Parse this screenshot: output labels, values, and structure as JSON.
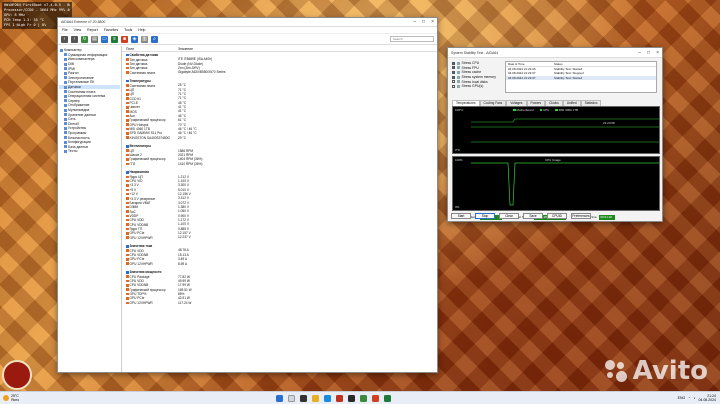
{
  "osd": {
    "lines": [
      "HWiNFO64 FirstBoot v7.4.0.5 - Beta for Intel...",
      "Processor/CCD0 - 3664 MHz 99% 4C/8T...",
      "GPU: 8 MHz",
      "PCH Temp 1.3: 35 °C",
      "FPS 1 Nigh Fr 0 | 0%"
    ]
  },
  "aida": {
    "title": "AIDA64 Extreme v7.20.6800",
    "menu": [
      "File",
      "View",
      "Report",
      "Favorites",
      "Tools",
      "Help"
    ],
    "search_placeholder": "Search",
    "col_field": "Поле",
    "col_value": "Значение",
    "tree": [
      {
        "label": "Компьютер",
        "sel": false
      },
      {
        "label": "Суммарная информация",
        "sel": false
      },
      {
        "label": "Имя компьютера",
        "sel": false
      },
      {
        "label": "DMI",
        "sel": false
      },
      {
        "label": "IPMI",
        "sel": false
      },
      {
        "label": "Разгон",
        "sel": false
      },
      {
        "label": "Электропитание",
        "sel": false
      },
      {
        "label": "Портативные ПК",
        "sel": false
      },
      {
        "label": "Датчики",
        "sel": true
      },
      {
        "label": "Системная плата",
        "sel": false
      },
      {
        "label": "Операционная система",
        "sel": false
      },
      {
        "label": "Сервер",
        "sel": false
      },
      {
        "label": "Отображение",
        "sel": false
      },
      {
        "label": "Мультимедиа",
        "sel": false
      },
      {
        "label": "Хранение данных",
        "sel": false
      },
      {
        "label": "Сеть",
        "sel": false
      },
      {
        "label": "DirectX",
        "sel": false
      },
      {
        "label": "Устройства",
        "sel": false
      },
      {
        "label": "Программы",
        "sel": false
      },
      {
        "label": "Безопасность",
        "sel": false
      },
      {
        "label": "Конфигурация",
        "sel": false
      },
      {
        "label": "База данных",
        "sel": false
      },
      {
        "label": "Тесты",
        "sel": false
      }
    ],
    "rows": [
      {
        "f": "Свойства датчика",
        "v": "",
        "sec": true
      },
      {
        "f": "Тип датчика",
        "v": "ITE IT8689E (ISA A40h)",
        "sec": false
      },
      {
        "f": "Тип датчика",
        "v": "Diode (NV-Diode)",
        "sec": false
      },
      {
        "f": "Тип датчика",
        "v": "Zen (Zen-DRV)",
        "sec": false
      },
      {
        "f": "Системная плата",
        "v": "Gigabyte A520/B550/X570 Series",
        "sec": false
      },
      {
        "f": "",
        "v": "",
        "sec": false
      },
      {
        "f": "Температуры",
        "v": "",
        "sec": true
      },
      {
        "f": "Системная плата",
        "v": "25 °C",
        "sec": false
      },
      {
        "f": "ЦП",
        "v": "71 °C",
        "sec": false
      },
      {
        "f": "ЦП",
        "v": "71 °C",
        "sec": false
      },
      {
        "f": "CCD #1",
        "v": "71 °C",
        "sec": false
      },
      {
        "f": "PCI-E",
        "v": "45 °C",
        "sec": false
      },
      {
        "f": "Чипсет",
        "v": "41 °C",
        "sec": false
      },
      {
        "f": "MOS",
        "v": "41 °C",
        "sec": false
      },
      {
        "f": "Aux",
        "v": "46 °C",
        "sec": false
      },
      {
        "f": "Графический процессор",
        "v": "61 °C",
        "sec": false
      },
      {
        "f": "GPU Hotspot",
        "v": "70 °C",
        "sec": false
      },
      {
        "f": "MSI 4060 1TB",
        "v": "46 °C / 46 °C",
        "sec": false
      },
      {
        "f": "SPD GAMMIX S11 Pro",
        "v": "46 °C / 46 °C",
        "sec": false
      },
      {
        "f": "KINGSTON SA400S37480G",
        "v": "29 °C",
        "sec": false
      },
      {
        "f": "",
        "v": "",
        "sec": false
      },
      {
        "f": "Вентиляторы",
        "v": "",
        "sec": true
      },
      {
        "f": "ЦП",
        "v": "1586 RPM",
        "sec": false
      },
      {
        "f": "Шасси 2",
        "v": "2021 RPM",
        "sec": false
      },
      {
        "f": "Графический процессор",
        "v": "1404 RPM (36%)",
        "sec": false
      },
      {
        "f": "ГП2",
        "v": "1410 RPM (36%)",
        "sec": false
      },
      {
        "f": "",
        "v": "",
        "sec": false
      },
      {
        "f": "Напряжения",
        "v": "",
        "sec": true
      },
      {
        "f": "Ядро ЦП",
        "v": "1.212 V",
        "sec": false
      },
      {
        "f": "CPU VID",
        "v": "1.100 V",
        "sec": false
      },
      {
        "f": "+3.3 V",
        "v": "3.300 V",
        "sec": false
      },
      {
        "f": "+5 V",
        "v": "5.010 V",
        "sec": false
      },
      {
        "f": "+12 V",
        "v": "12.156 V",
        "sec": false
      },
      {
        "f": "+3.3 V резервное",
        "v": "3.312 V",
        "sec": false
      },
      {
        "f": "Батарея VBAT",
        "v": "3.072 V",
        "sec": false
      },
      {
        "f": "DIMM",
        "v": "1.380 V",
        "sec": false
      },
      {
        "f": "SoC",
        "v": "1.050 V",
        "sec": false
      },
      {
        "f": "VDDP",
        "v": "0.900 V",
        "sec": false
      },
      {
        "f": "CPU VDD",
        "v": "1.172 V",
        "sec": false
      },
      {
        "f": "CPU VDDNB",
        "v": "1.100 V",
        "sec": false
      },
      {
        "f": "Ядро ГП",
        "v": "0.885 V",
        "sec": false
      },
      {
        "f": "GPU PCIe",
        "v": "12.157 V",
        "sec": false
      },
      {
        "f": "GPU 12VHPWR",
        "v": "12.237 V",
        "sec": false
      },
      {
        "f": "",
        "v": "",
        "sec": false
      },
      {
        "f": "Значения тока",
        "v": "",
        "sec": true
      },
      {
        "f": "CPU VDD",
        "v": "48.78 A",
        "sec": false
      },
      {
        "f": "CPU VDDNB",
        "v": "15.13 A",
        "sec": false
      },
      {
        "f": "GPU PCIe",
        "v": "3.49 A",
        "sec": false
      },
      {
        "f": "GPU 12VHPWR",
        "v": "8.59 A",
        "sec": false
      },
      {
        "f": "",
        "v": "",
        "sec": false
      },
      {
        "f": "Значения мощности",
        "v": "",
        "sec": true
      },
      {
        "f": "CPU Package",
        "v": "77.82 W",
        "sec": false
      },
      {
        "f": "CPU VDD",
        "v": "49.99 W",
        "sec": false
      },
      {
        "f": "CPU VDDNB",
        "v": "17.99 W",
        "sec": false
      },
      {
        "f": "Графический процессор",
        "v": "169.51 W",
        "sec": false
      },
      {
        "f": "GPU TDP%",
        "v": "85%",
        "sec": false
      },
      {
        "f": "GPU PCIe",
        "v": "42.91 W",
        "sec": false
      },
      {
        "f": "GPU 12VHPWR",
        "v": "117.24 W",
        "sec": false
      }
    ]
  },
  "sst": {
    "title": "System Stability Test - AIDA64",
    "checks": [
      {
        "label": "Stress CPU",
        "on": true
      },
      {
        "label": "Stress FPU",
        "on": true
      },
      {
        "label": "Stress cache",
        "on": true
      },
      {
        "label": "Stress system memory",
        "on": true
      },
      {
        "label": "Stress local disks",
        "on": false
      },
      {
        "label": "Stress GPU(s)",
        "on": false
      }
    ],
    "log_head": [
      "Date & Time",
      "Status"
    ],
    "log": [
      {
        "t": "04.08.2024 21:22:06",
        "s": "Stability Test: Started",
        "hl": false
      },
      {
        "t": "04.08.2024 21:23:07",
        "s": "Stability Test: Stopped",
        "hl": false
      },
      {
        "t": "04.08.2024 21:23:07",
        "s": "Stability Test: Started",
        "hl": true
      }
    ],
    "tabs": [
      "Temperatures",
      "Cooling Fans",
      "Voltages",
      "Powers",
      "Clocks",
      "Unified",
      "Statistics"
    ],
    "graph1": {
      "legend": [
        "Motherboard",
        "CPU",
        "MSI 4060 1TB"
      ],
      "top": "100°C",
      "bottom": "0°C",
      "stamp": "21:23:08"
    },
    "graph2": {
      "title": "CPU Usage",
      "top": "100%",
      "bottom": "0%"
    },
    "battery_label": "Remaining Battery:",
    "battery_value": "No battery",
    "started_label": "Test Started:",
    "started_value": "04.08.2024 21:23:07",
    "elapsed_label": "Elapsed Time:",
    "elapsed_value": "00:01:22",
    "buttons": [
      "Start",
      "Stop",
      "Clear",
      "Save",
      "CPUID",
      "Preferences"
    ]
  },
  "watermark": "Avito",
  "taskbar": {
    "temp": "25°C",
    "weather": "Ясно",
    "lang": "ENG",
    "time": "21:24",
    "date": "04.08.2024"
  },
  "colors": {
    "graph_line": "#33cc33",
    "battery_bg": "#1e8a1e"
  }
}
